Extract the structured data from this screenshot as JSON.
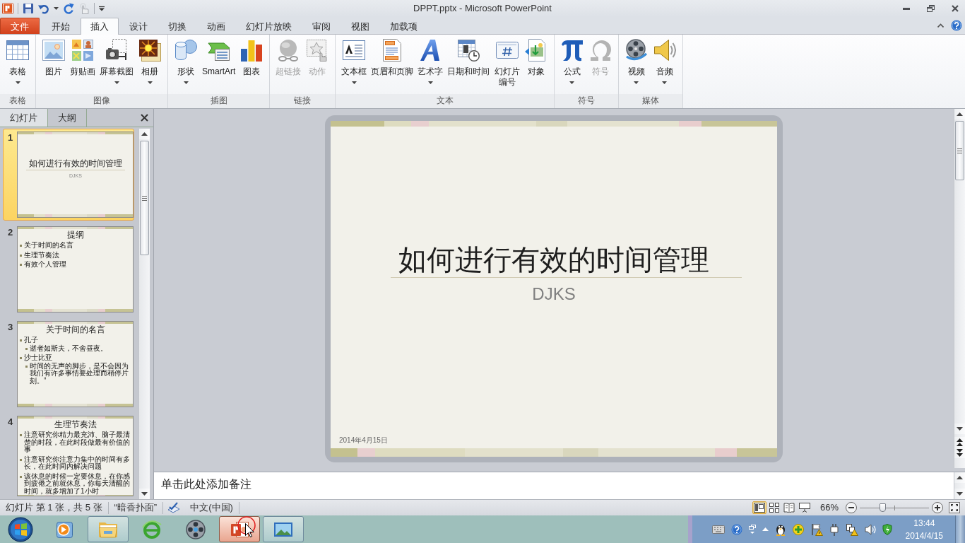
{
  "window": {
    "title": "DPPT.pptx - Microsoft PowerPoint"
  },
  "ribbon_tabs": [
    {
      "label": "文件",
      "kind": "file",
      "selected": false
    },
    {
      "label": "开始",
      "kind": "tab",
      "selected": false
    },
    {
      "label": "插入",
      "kind": "tab",
      "selected": true
    },
    {
      "label": "设计",
      "kind": "tab",
      "selected": false
    },
    {
      "label": "切换",
      "kind": "tab",
      "selected": false
    },
    {
      "label": "动画",
      "kind": "tab",
      "selected": false
    },
    {
      "label": "幻灯片放映",
      "kind": "tab",
      "selected": false
    },
    {
      "label": "审阅",
      "kind": "tab",
      "selected": false
    },
    {
      "label": "视图",
      "kind": "tab",
      "selected": false
    },
    {
      "label": "加载项",
      "kind": "tab",
      "selected": false
    }
  ],
  "ribbon_groups": [
    {
      "label": "表格",
      "commands": [
        {
          "label": "表格",
          "dropdown": true,
          "disabled": false
        }
      ]
    },
    {
      "label": "图像",
      "commands": [
        {
          "label": "图片",
          "dropdown": false,
          "disabled": false
        },
        {
          "label": "剪贴画",
          "dropdown": false,
          "disabled": false
        },
        {
          "label": "屏幕截图",
          "dropdown": true,
          "disabled": false
        },
        {
          "label": "相册",
          "dropdown": true,
          "disabled": false
        }
      ]
    },
    {
      "label": "插图",
      "commands": [
        {
          "label": "形状",
          "dropdown": true,
          "disabled": false
        },
        {
          "label": "SmartArt",
          "dropdown": false,
          "disabled": false
        },
        {
          "label": "图表",
          "dropdown": false,
          "disabled": false
        }
      ]
    },
    {
      "label": "链接",
      "commands": [
        {
          "label": "超链接",
          "dropdown": false,
          "disabled": true
        },
        {
          "label": "动作",
          "dropdown": false,
          "disabled": true
        }
      ]
    },
    {
      "label": "文本",
      "commands": [
        {
          "label": "文本框",
          "dropdown": true,
          "disabled": false
        },
        {
          "label": "页眉和页脚",
          "dropdown": false,
          "disabled": false
        },
        {
          "label": "艺术字",
          "dropdown": true,
          "disabled": false
        },
        {
          "label": "日期和时间",
          "dropdown": false,
          "disabled": false
        },
        {
          "label": "幻灯片编号",
          "dropdown": false,
          "disabled": false
        },
        {
          "label": "对象",
          "dropdown": false,
          "disabled": false
        }
      ]
    },
    {
      "label": "符号",
      "commands": [
        {
          "label": "公式",
          "dropdown": true,
          "disabled": false
        },
        {
          "label": "符号",
          "dropdown": false,
          "disabled": true
        }
      ]
    },
    {
      "label": "媒体",
      "commands": [
        {
          "label": "视频",
          "dropdown": true,
          "disabled": false
        },
        {
          "label": "音频",
          "dropdown": true,
          "disabled": false
        }
      ]
    }
  ],
  "slides_pane": {
    "tabs": [
      {
        "label": "幻灯片",
        "selected": true
      },
      {
        "label": "大纲",
        "selected": false
      }
    ],
    "thumbnails": [
      {
        "number": "1",
        "selected": true,
        "kind": "title",
        "title": "如何进行有效的时间管理",
        "subtitle": "DJKS"
      },
      {
        "number": "2",
        "selected": false,
        "kind": "bullets",
        "title": "提纲",
        "bullets": [
          {
            "text": "关于时间的名言"
          },
          {
            "text": "生理节奏法"
          },
          {
            "text": "有效个人管理"
          }
        ]
      },
      {
        "number": "3",
        "selected": false,
        "kind": "bullets",
        "title": "关于时间的名言",
        "bullets": [
          {
            "text": "孔子",
            "children": [
              {
                "text": "逝者如斯夫，不舍昼夜。"
              }
            ]
          },
          {
            "text": "沙士比亚",
            "children": [
              {
                "text": "时间的无声的脚步，是不会因为我们有许多事情要处理而稍停片刻。”"
              }
            ]
          }
        ]
      },
      {
        "number": "4",
        "selected": false,
        "kind": "bullets",
        "title": "生理节奏法",
        "bullets": [
          {
            "text": "注意研究你精力最充沛、脑子最清楚的时段，在此时段做最有价值的事"
          },
          {
            "text": "注意研究你注意力集中的时间有多长，在此时间内解决问题"
          },
          {
            "text": "该休息的时候一定要休息，在你感到疲倦之前就休息，你每天清醒的时间，就多增加了1小时"
          }
        ]
      }
    ]
  },
  "slide": {
    "title": "如何进行有效的时间管理",
    "subtitle": "DJKS",
    "date": "2014年4月15日"
  },
  "notes": {
    "placeholder": "单击此处添加备注"
  },
  "status_bar": {
    "slide_info": "幻灯片 第 1 张，共 5 张",
    "theme": "“暗香扑面”",
    "language": "中文(中国)",
    "views": [
      {
        "selected": true
      },
      {
        "selected": false
      },
      {
        "selected": false
      },
      {
        "selected": false
      }
    ],
    "zoom": {
      "reading": "66%",
      "level": 0.32
    }
  },
  "taskbar": {
    "apps": [
      {
        "running": false,
        "selected": false
      },
      {
        "running": true,
        "selected": false
      },
      {
        "running": false,
        "selected": false
      },
      {
        "running": false,
        "selected": false
      },
      {
        "running": true,
        "selected": true
      },
      {
        "running": true,
        "selected": false
      }
    ],
    "clock": {
      "time": "13:44",
      "date": "2014/4/15"
    }
  }
}
